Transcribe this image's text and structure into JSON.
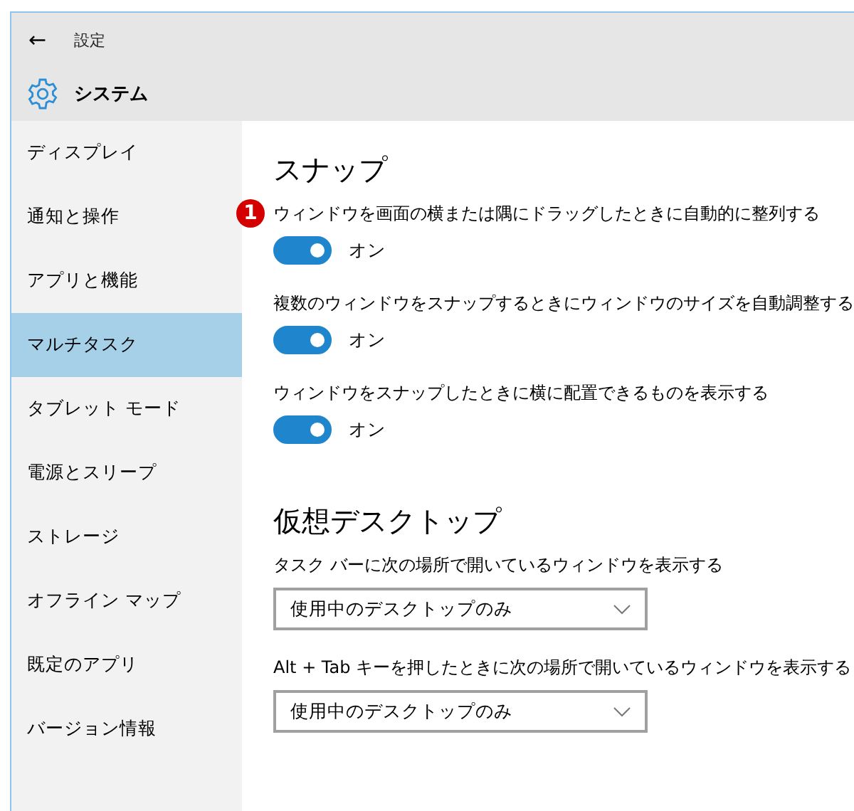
{
  "header": {
    "back_icon": "←",
    "title": "設定",
    "section": "システム"
  },
  "sidebar": {
    "items": [
      {
        "label": "ディスプレイ",
        "selected": false
      },
      {
        "label": "通知と操作",
        "selected": false
      },
      {
        "label": "アプリと機能",
        "selected": false
      },
      {
        "label": "マルチタスク",
        "selected": true
      },
      {
        "label": "タブレット モード",
        "selected": false
      },
      {
        "label": "電源とスリープ",
        "selected": false
      },
      {
        "label": "ストレージ",
        "selected": false
      },
      {
        "label": "オフライン マップ",
        "selected": false
      },
      {
        "label": "既定のアプリ",
        "selected": false
      },
      {
        "label": "バージョン情報",
        "selected": false
      }
    ]
  },
  "sections": [
    {
      "title": "スナップ",
      "settings": [
        {
          "kind": "toggle",
          "label": "ウィンドウを画面の横または隅にドラッグしたときに自動的に整列する",
          "callout": "1",
          "on": true,
          "state_text": "オン"
        },
        {
          "kind": "toggle",
          "label": "複数のウィンドウをスナップするときにウィンドウのサイズを自動調整する",
          "on": true,
          "state_text": "オン"
        },
        {
          "kind": "toggle",
          "label": "ウィンドウをスナップしたときに横に配置できるものを表示する",
          "on": true,
          "state_text": "オン"
        }
      ]
    },
    {
      "title": "仮想デスクトップ",
      "settings": [
        {
          "kind": "dropdown",
          "label": "タスク バーに次の場所で開いているウィンドウを表示する",
          "value": "使用中のデスクトップのみ"
        },
        {
          "kind": "dropdown",
          "label": "Alt + Tab キーを押したときに次の場所で開いているウィンドウを表示する",
          "value": "使用中のデスクトップのみ"
        }
      ]
    }
  ]
}
